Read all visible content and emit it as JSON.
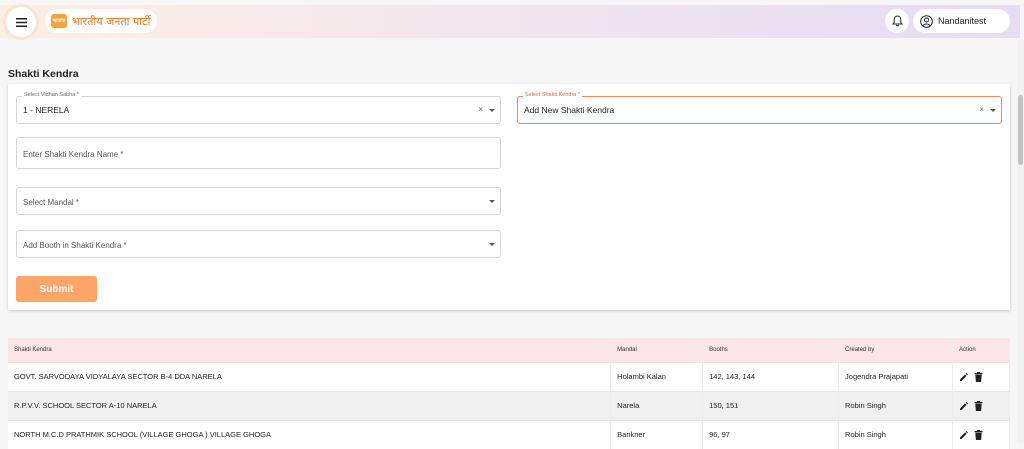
{
  "header": {
    "logo_text": "भारतीय जनता पार्टी",
    "logo_mark": "भाजपा",
    "username": "Nandanitest"
  },
  "page": {
    "title": "Shakti Kendra"
  },
  "form": {
    "vidhan_sabha": {
      "label": "Select Vidhan Sabha *",
      "value": "1 - NERELA",
      "clear": "×"
    },
    "shakti_kendra": {
      "label": "Select Shakti Kendra *",
      "value": "Add New Shakti Kendra",
      "clear": "×"
    },
    "kendra_name": {
      "placeholder": "Enter Shakti Kendra Name *"
    },
    "mandal": {
      "placeholder": "Select Mandal *"
    },
    "booth": {
      "placeholder": "Add Booth in Shakti Kendra *"
    },
    "submit_label": "Submit"
  },
  "table": {
    "columns": [
      "Shakti Kendra",
      "Mandal",
      "Booths",
      "Created by",
      "Action"
    ],
    "rows": [
      {
        "kendra": "GOVT. SARVODAYA VIDYALAYA SECTOR B-4 DDA NARELA",
        "mandal": "Holambi Kalan",
        "booths": "142, 143, 144",
        "created_by": "Jogendra Prajapati"
      },
      {
        "kendra": "R.P.V.V. SCHOOL SECTOR A-10 NARELA",
        "mandal": "Narela",
        "booths": "150, 151",
        "created_by": "Robin Singh"
      },
      {
        "kendra": "NORTH M.C.D PRATHMIK SCHOOL (VILLAGE GHOGA ) VILLAGE GHOGA",
        "mandal": "Bankner",
        "booths": "96, 97",
        "created_by": "Robin Singh"
      }
    ]
  },
  "colors": {
    "accent": "#ffa56a",
    "focus_border": "#f08a5d",
    "table_header_bg": "#fce5e6"
  }
}
